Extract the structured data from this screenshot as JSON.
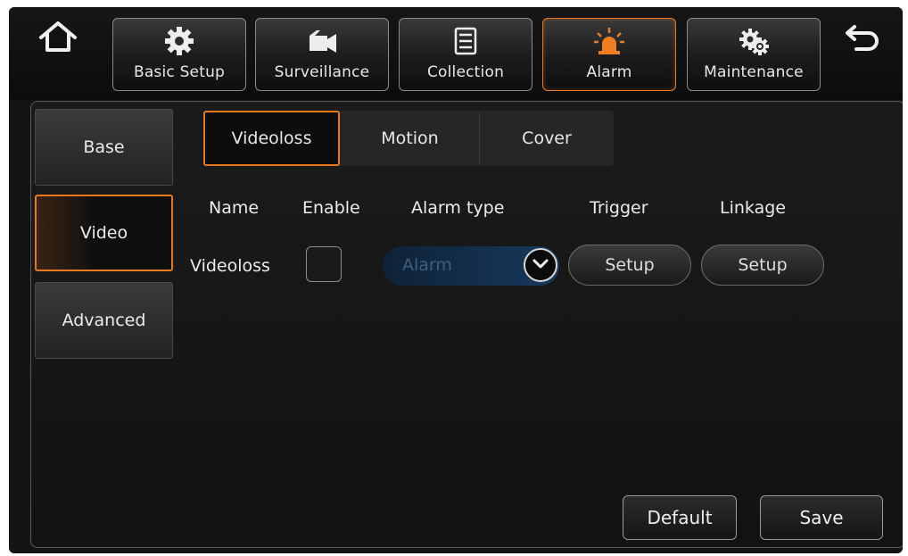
{
  "nav": {
    "tabs": [
      {
        "label": "Basic Setup",
        "icon": "gear-icon"
      },
      {
        "label": "Surveillance",
        "icon": "camera-icon"
      },
      {
        "label": "Collection",
        "icon": "document-icon"
      },
      {
        "label": "Alarm",
        "icon": "alarm-light-icon",
        "active": true
      },
      {
        "label": "Maintenance",
        "icon": "gears-icon"
      }
    ]
  },
  "sidebar": {
    "items": [
      {
        "label": "Base"
      },
      {
        "label": "Video",
        "active": true
      },
      {
        "label": "Advanced"
      }
    ]
  },
  "subtabs": [
    {
      "label": "Videoloss",
      "active": true
    },
    {
      "label": "Motion"
    },
    {
      "label": "Cover"
    }
  ],
  "table": {
    "headers": [
      "Name",
      "Enable",
      "Alarm type",
      "Trigger",
      "Linkage"
    ],
    "row": {
      "name": "Videoloss",
      "enabled": false,
      "alarm_type": "Alarm",
      "trigger_button": "Setup",
      "linkage_button": "Setup"
    }
  },
  "footer": {
    "default_label": "Default",
    "save_label": "Save"
  },
  "colors": {
    "accent": "#e7791c",
    "select_bg": "#173a5e",
    "panel_bg": "#141414"
  }
}
